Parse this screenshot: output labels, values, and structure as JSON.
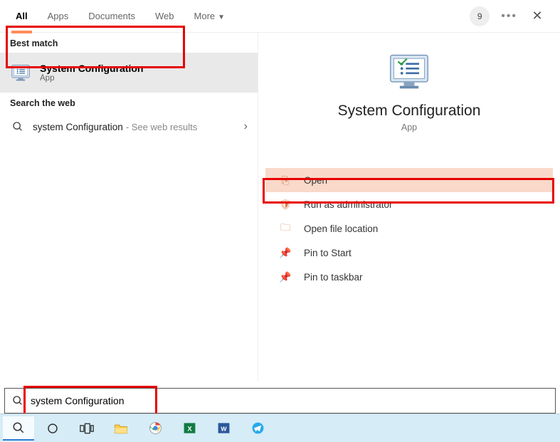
{
  "topbar": {
    "tabs": [
      "All",
      "Apps",
      "Documents",
      "Web",
      "More"
    ],
    "badge": "9"
  },
  "left": {
    "best_match_header": "Best match",
    "result_title": "System Configuration",
    "result_sub": "App",
    "search_web_header": "Search the web",
    "web_query": "system Configuration",
    "web_suffix": "- See web results"
  },
  "right": {
    "title": "System Configuration",
    "sub": "App",
    "actions": {
      "open": "Open",
      "run_admin": "Run as administrator",
      "file_loc": "Open file location",
      "pin_start": "Pin to Start",
      "pin_taskbar": "Pin to taskbar"
    }
  },
  "search": {
    "value": "system Configuration"
  },
  "taskbar": {
    "items": [
      "search",
      "cortana",
      "taskview",
      "explorer",
      "chrome",
      "excel",
      "word",
      "telegram"
    ]
  }
}
